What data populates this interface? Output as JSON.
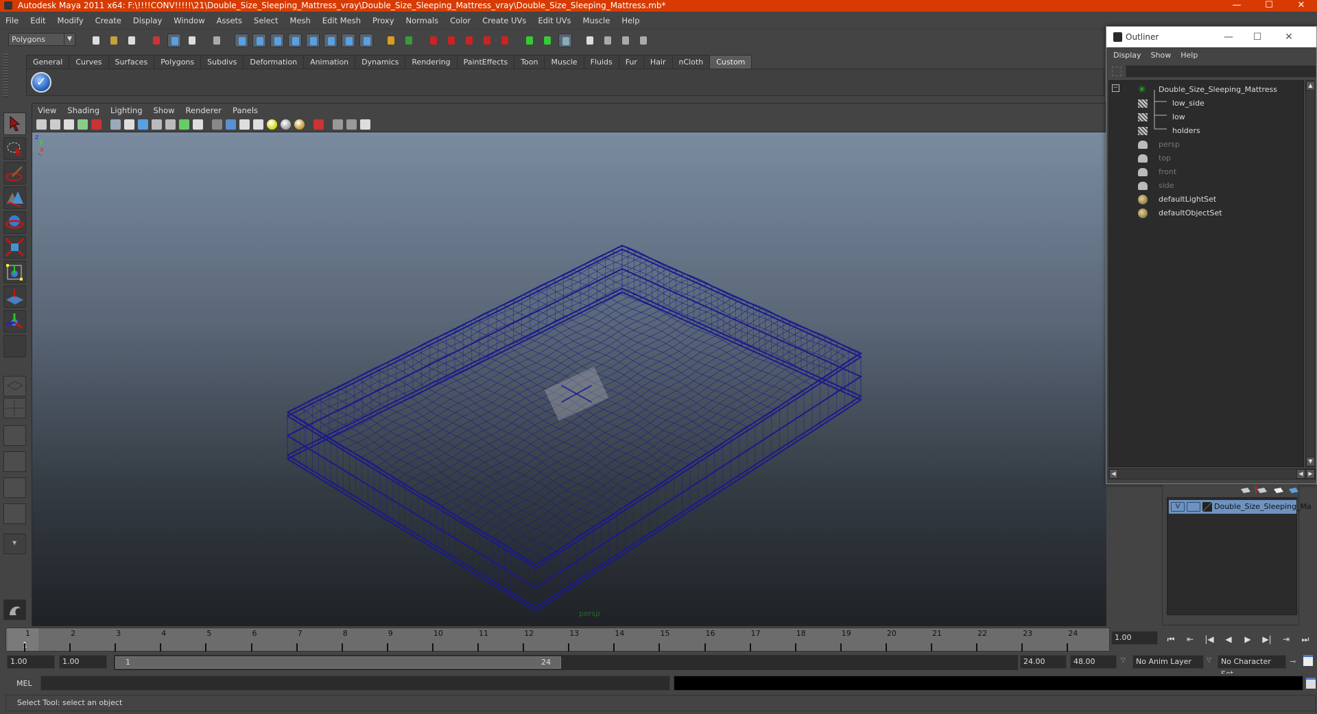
{
  "window": {
    "title": "Autodesk Maya 2011 x64: F:\\!!!!CONV!!!!!\\21\\Double_Size_Sleeping_Mattress_vray\\Double_Size_Sleeping_Mattress_vray\\Double_Size_Sleeping_Mattress.mb*",
    "minimize": "—",
    "maximize": "☐",
    "close": "✕"
  },
  "menubar": [
    "File",
    "Edit",
    "Modify",
    "Create",
    "Display",
    "Window",
    "Assets",
    "Select",
    "Mesh",
    "Edit Mesh",
    "Proxy",
    "Normals",
    "Color",
    "Create UVs",
    "Edit UVs",
    "Muscle",
    "Help"
  ],
  "statusline": {
    "mode": "Polygons",
    "icons": [
      "new-scene-icon",
      "open-scene-icon",
      "save-scene-icon",
      "select-by-hierarchy-icon",
      "select-by-object-icon",
      "select-by-component-icon",
      "mask-menu-icon",
      "select-handles-icon",
      "select-joints-icon",
      "select-curves-icon",
      "select-surfaces-icon",
      "select-deformations-icon",
      "select-dynamics-icon",
      "select-rendering-icon",
      "select-misc-icon",
      "lock-selection-icon",
      "highlight-selection-icon",
      "snap-grid-icon",
      "snap-curve-icon",
      "snap-point-icon",
      "snap-view-plane-icon",
      "make-live-icon",
      "input-ops-icon",
      "output-ops-icon",
      "construction-history-icon",
      "render-view-icon",
      "render-current-icon",
      "ipr-render-icon",
      "render-settings-icon"
    ]
  },
  "shelf": {
    "tabs": [
      "General",
      "Curves",
      "Surfaces",
      "Polygons",
      "Subdivs",
      "Deformation",
      "Animation",
      "Dynamics",
      "Rendering",
      "PaintEffects",
      "Toon",
      "Muscle",
      "Fluids",
      "Fur",
      "Hair",
      "nCloth",
      "Custom"
    ],
    "active_tab": "Custom",
    "buttons": [
      "checkmark-tool-icon"
    ]
  },
  "toolbox": {
    "tools": [
      "select-tool",
      "lasso-tool",
      "paint-select-tool",
      "move-tool",
      "rotate-tool",
      "scale-tool",
      "universal-manipulator",
      "soft-mod-tool",
      "show-manipulator",
      "last-used-tool"
    ],
    "selected": "select-tool",
    "layouts": [
      "single-perspective-layout",
      "four-view-layout",
      "outliner-persp-layout",
      "persp-graph-layout",
      "hypershade-persp-layout",
      "persp-graph-hypergraph-layout"
    ]
  },
  "panel": {
    "menus": [
      "View",
      "Shading",
      "Lighting",
      "Show",
      "Renderer",
      "Panels"
    ],
    "camera_label": "persp",
    "axis": {
      "x": "x",
      "y": "y",
      "z": "z"
    }
  },
  "viewport": {
    "wire_color": "#1a1a8c",
    "bg_top": "#7a8ba0",
    "bg_bottom": "#1f2226"
  },
  "outliner": {
    "title": "Outliner",
    "menus": [
      "Display",
      "Show",
      "Help"
    ],
    "filter_value": "",
    "items": [
      {
        "label": "Double_Size_Sleeping_Mattress",
        "icon": "transform-group-icon",
        "dim": false,
        "child": false
      },
      {
        "label": "low_side",
        "icon": "mesh-icon",
        "dim": false,
        "child": true
      },
      {
        "label": "low",
        "icon": "mesh-icon",
        "dim": false,
        "child": true
      },
      {
        "label": "holders",
        "icon": "mesh-icon",
        "dim": false,
        "child": true
      },
      {
        "label": "persp",
        "icon": "camera-icon",
        "dim": true,
        "child": false
      },
      {
        "label": "top",
        "icon": "camera-icon",
        "dim": true,
        "child": false
      },
      {
        "label": "front",
        "icon": "camera-icon",
        "dim": true,
        "child": false
      },
      {
        "label": "side",
        "icon": "camera-icon",
        "dim": true,
        "child": false
      },
      {
        "label": "defaultLightSet",
        "icon": "set-icon",
        "dim": false,
        "child": false
      },
      {
        "label": "defaultObjectSet",
        "icon": "set-icon",
        "dim": false,
        "child": false
      }
    ]
  },
  "layer_editor": {
    "layers": [
      {
        "visible": "V",
        "name": "Double_Size_Sleeping_Ma"
      }
    ]
  },
  "timeline": {
    "ticks": [
      "1",
      "2",
      "3",
      "4",
      "5",
      "6",
      "7",
      "8",
      "9",
      "10",
      "11",
      "12",
      "13",
      "14",
      "15",
      "16",
      "17",
      "18",
      "19",
      "20",
      "21",
      "22",
      "23",
      "24"
    ],
    "current_frame_marker": "1",
    "current_time": "1.00"
  },
  "range": {
    "start_time": "1.00",
    "playback_start": "1.00",
    "range_start_label": "1",
    "range_end_label": "24",
    "playback_end": "24.00",
    "end_time": "48.00",
    "anim_layer": "No Anim Layer",
    "character_set": "No Character Set"
  },
  "playback": [
    "go-to-start",
    "step-back-key",
    "step-back-frame",
    "play-backwards",
    "play-forwards",
    "step-forward-frame",
    "step-forward-key",
    "go-to-end"
  ],
  "playback_glyphs": [
    "⏮",
    "⇤",
    "|◀",
    "◀",
    "▶",
    "▶|",
    "⇥",
    "⏭"
  ],
  "mel": {
    "label": "MEL",
    "input": "",
    "result": ""
  },
  "helpline": "Select Tool: select an object"
}
